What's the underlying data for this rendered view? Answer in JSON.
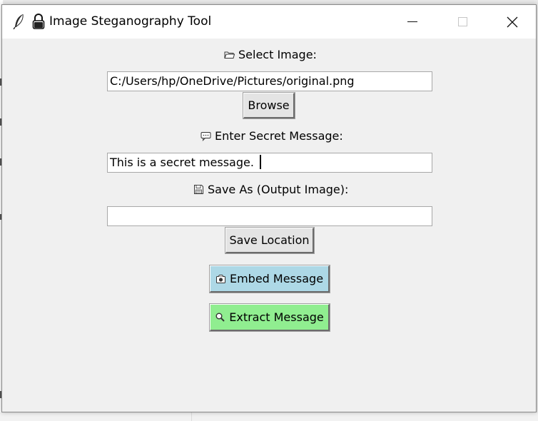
{
  "window": {
    "title": "Image Steganography Tool",
    "app_icon": "feather-icon",
    "title_icon": "lock-icon"
  },
  "select_image": {
    "label": "Select Image:",
    "icon": "folder-icon",
    "path_value": "C:/Users/hp/OneDrive/Pictures/original.png",
    "browse_label": "Browse"
  },
  "secret_message": {
    "label": "Enter Secret Message:",
    "icon": "speech-bubble-icon",
    "value": "This is a secret message."
  },
  "save_as": {
    "label": "Save As (Output Image):",
    "icon": "floppy-disk-icon",
    "value": "",
    "save_location_label": "Save Location"
  },
  "actions": {
    "embed_label": "Embed Message",
    "embed_icon": "camera-icon",
    "embed_color": "#add8e6",
    "extract_label": "Extract Message",
    "extract_icon": "magnifier-icon",
    "extract_color": "#90ee90"
  }
}
